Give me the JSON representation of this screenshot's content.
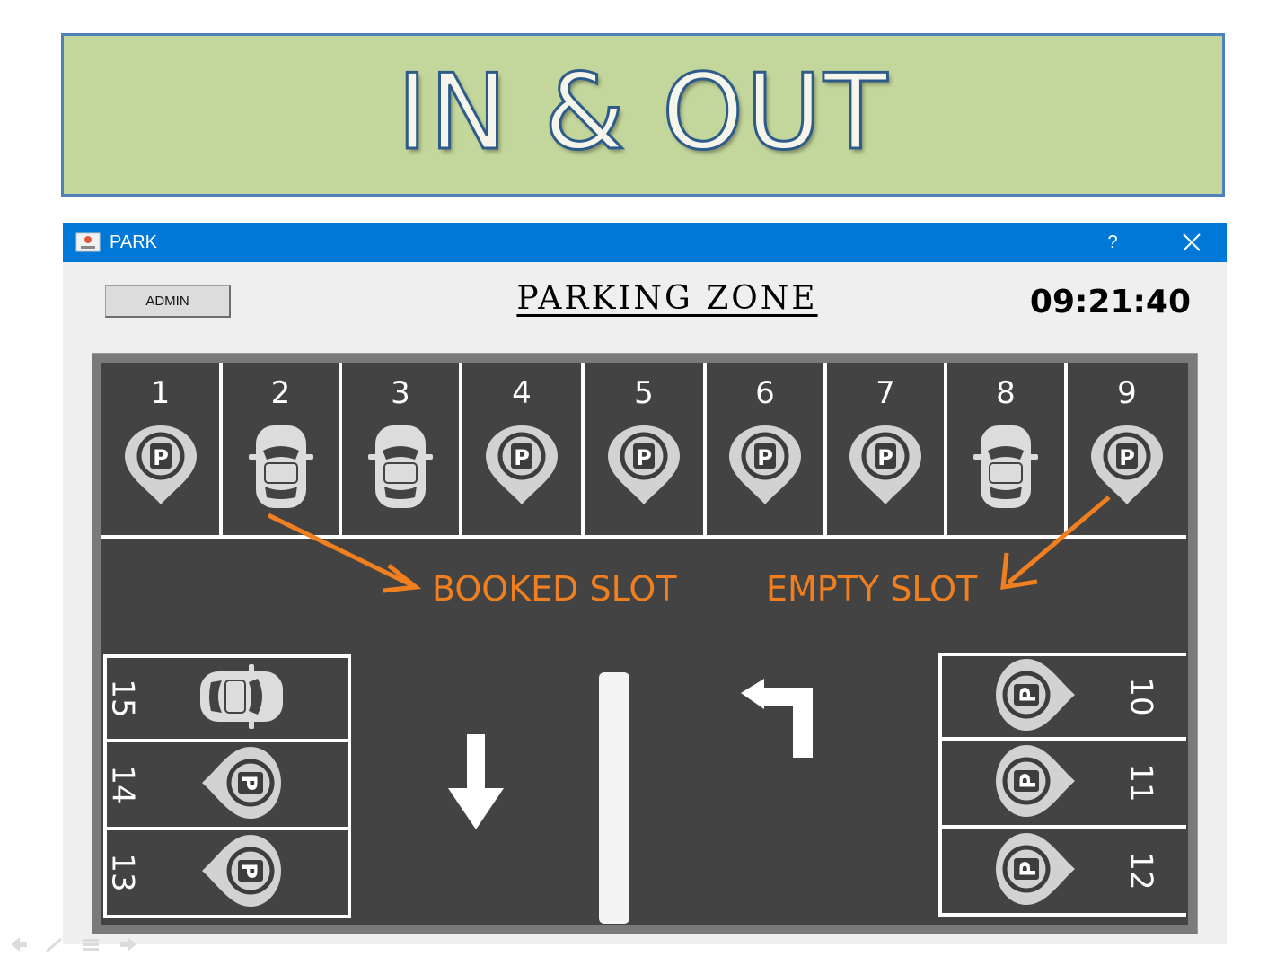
{
  "banner": {
    "title": "IN & OUT"
  },
  "window": {
    "title": "PARK",
    "help_label": "?",
    "icons": {
      "app": "app-icon",
      "close": "close-icon"
    },
    "titlebar_color": "#0078d7"
  },
  "toolbar": {
    "admin_label": "ADMIN"
  },
  "header": {
    "zone_title": "PARKING ZONE",
    "clock": "09:21:40"
  },
  "annotations": {
    "booked": "BOOKED SLOT",
    "empty": "EMPTY SLOT",
    "color": "#f07f1f"
  },
  "slots": {
    "top": [
      {
        "number": "1",
        "status": "empty"
      },
      {
        "number": "2",
        "status": "booked"
      },
      {
        "number": "3",
        "status": "booked"
      },
      {
        "number": "4",
        "status": "empty"
      },
      {
        "number": "5",
        "status": "empty"
      },
      {
        "number": "6",
        "status": "empty"
      },
      {
        "number": "7",
        "status": "empty"
      },
      {
        "number": "8",
        "status": "booked"
      },
      {
        "number": "9",
        "status": "empty"
      }
    ],
    "left": [
      {
        "number": "15",
        "status": "booked"
      },
      {
        "number": "14",
        "status": "empty"
      },
      {
        "number": "13",
        "status": "empty"
      }
    ],
    "right": [
      {
        "number": "10",
        "status": "empty"
      },
      {
        "number": "11",
        "status": "empty"
      },
      {
        "number": "12",
        "status": "empty"
      }
    ]
  },
  "road": {
    "icons": [
      "down-arrow-icon",
      "turn-left-arrow-icon",
      "lane-divider"
    ]
  }
}
